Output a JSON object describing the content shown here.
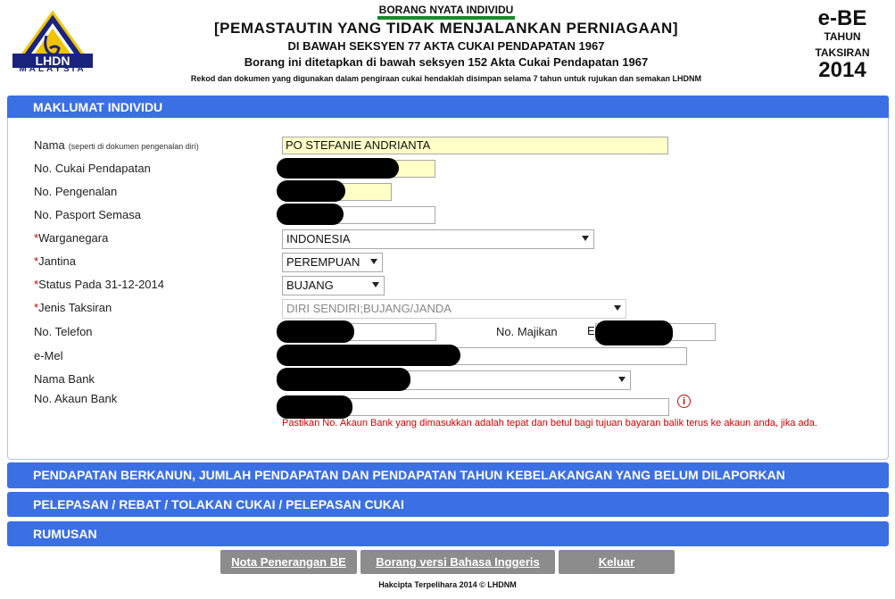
{
  "header": {
    "logo_text": "LHDN",
    "logo_sub": "MALAYSIA",
    "line1": "BORANG NYATA INDIVIDU",
    "line2": "[PEMASTAUTIN YANG TIDAK MENJALANKAN PERNIAGAAN]",
    "line3": "DI BAWAH SEKSYEN 77 AKTA CUKAI PENDAPATAN 1967",
    "line4": "Borang ini ditetapkan di bawah seksyen 152 Akta Cukai Pendapatan 1967",
    "line5": "Rekod dan dokumen yang digunakan dalam pengiraan cukai hendaklah disimpan selama 7 tahun untuk rujukan dan semakan LHDNM",
    "form_code": "e-BE",
    "tahun": "TAHUN",
    "taksiran": "TAKSIRAN",
    "year": "2014"
  },
  "sections": {
    "maklumat": "MAKLUMAT INDIVIDU",
    "pendapatan": "PENDAPATAN BERKANUN, JUMLAH PENDAPATAN DAN PENDAPATAN TAHUN KEBELAKANGAN YANG BELUM DILAPORKAN",
    "pelepasan": "PELEPASAN / REBAT / TOLAKAN CUKAI / PELEPASAN CUKAI",
    "rumusan": "RUMUSAN"
  },
  "form": {
    "nama_label": "Nama",
    "nama_hint": "(seperti di dokumen pengenalan diri)",
    "nama_value": "PO STEFANIE ANDRIANTA",
    "cukai_label": "No. Cukai Pendapatan",
    "pengenalan_label": "No. Pengenalan",
    "pasport_label": "No. Pasport Semasa",
    "warganegara_label": "Warganegara",
    "warganegara_value": "INDONESIA",
    "jantina_label": "Jantina",
    "jantina_value": "PEREMPUAN",
    "status_label": "Status Pada 31-12-2014",
    "status_value": "BUJANG",
    "jenis_label": "Jenis Taksiran",
    "jenis_value": "DIRI SENDIRI;BUJANG/JANDA",
    "telefon_label": "No. Telefon",
    "majikan_label": "No. Majikan",
    "majikan_prefix": "E",
    "emel_label": "e-Mel",
    "bank_label": "Nama Bank",
    "akaun_label": "No. Akaun Bank",
    "required_mark": "*",
    "akaun_warning": "Pastikan No. Akaun Bank yang dimasukkan adalah tepat dan betul bagi tujuan bayaran balik terus ke akaun anda, jika ada.",
    "info_glyph": "i"
  },
  "buttons": {
    "nota": "Nota Penerangan BE",
    "english": "Borang versi Bahasa Inggeris",
    "keluar": "Keluar"
  },
  "footer": "Hakcipta Terpelihara 2014 © LHDNM",
  "colors": {
    "section_bar": "#3b6fe4",
    "button": "#8c8c8c",
    "required": "#cc0000",
    "highlight_input": "#ffffc8"
  }
}
